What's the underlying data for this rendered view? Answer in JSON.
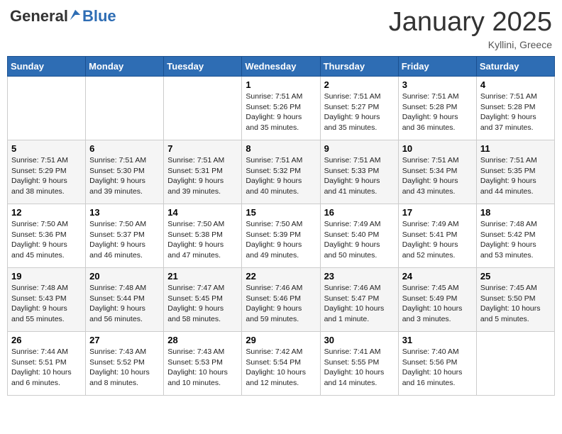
{
  "header": {
    "logo_general": "General",
    "logo_blue": "Blue",
    "month": "January 2025",
    "location": "Kyllini, Greece"
  },
  "days_of_week": [
    "Sunday",
    "Monday",
    "Tuesday",
    "Wednesday",
    "Thursday",
    "Friday",
    "Saturday"
  ],
  "weeks": [
    [
      {
        "day": "",
        "content": ""
      },
      {
        "day": "",
        "content": ""
      },
      {
        "day": "",
        "content": ""
      },
      {
        "day": "1",
        "content": "Sunrise: 7:51 AM\nSunset: 5:26 PM\nDaylight: 9 hours\nand 35 minutes."
      },
      {
        "day": "2",
        "content": "Sunrise: 7:51 AM\nSunset: 5:27 PM\nDaylight: 9 hours\nand 35 minutes."
      },
      {
        "day": "3",
        "content": "Sunrise: 7:51 AM\nSunset: 5:28 PM\nDaylight: 9 hours\nand 36 minutes."
      },
      {
        "day": "4",
        "content": "Sunrise: 7:51 AM\nSunset: 5:28 PM\nDaylight: 9 hours\nand 37 minutes."
      }
    ],
    [
      {
        "day": "5",
        "content": "Sunrise: 7:51 AM\nSunset: 5:29 PM\nDaylight: 9 hours\nand 38 minutes."
      },
      {
        "day": "6",
        "content": "Sunrise: 7:51 AM\nSunset: 5:30 PM\nDaylight: 9 hours\nand 39 minutes."
      },
      {
        "day": "7",
        "content": "Sunrise: 7:51 AM\nSunset: 5:31 PM\nDaylight: 9 hours\nand 39 minutes."
      },
      {
        "day": "8",
        "content": "Sunrise: 7:51 AM\nSunset: 5:32 PM\nDaylight: 9 hours\nand 40 minutes."
      },
      {
        "day": "9",
        "content": "Sunrise: 7:51 AM\nSunset: 5:33 PM\nDaylight: 9 hours\nand 41 minutes."
      },
      {
        "day": "10",
        "content": "Sunrise: 7:51 AM\nSunset: 5:34 PM\nDaylight: 9 hours\nand 43 minutes."
      },
      {
        "day": "11",
        "content": "Sunrise: 7:51 AM\nSunset: 5:35 PM\nDaylight: 9 hours\nand 44 minutes."
      }
    ],
    [
      {
        "day": "12",
        "content": "Sunrise: 7:50 AM\nSunset: 5:36 PM\nDaylight: 9 hours\nand 45 minutes."
      },
      {
        "day": "13",
        "content": "Sunrise: 7:50 AM\nSunset: 5:37 PM\nDaylight: 9 hours\nand 46 minutes."
      },
      {
        "day": "14",
        "content": "Sunrise: 7:50 AM\nSunset: 5:38 PM\nDaylight: 9 hours\nand 47 minutes."
      },
      {
        "day": "15",
        "content": "Sunrise: 7:50 AM\nSunset: 5:39 PM\nDaylight: 9 hours\nand 49 minutes."
      },
      {
        "day": "16",
        "content": "Sunrise: 7:49 AM\nSunset: 5:40 PM\nDaylight: 9 hours\nand 50 minutes."
      },
      {
        "day": "17",
        "content": "Sunrise: 7:49 AM\nSunset: 5:41 PM\nDaylight: 9 hours\nand 52 minutes."
      },
      {
        "day": "18",
        "content": "Sunrise: 7:48 AM\nSunset: 5:42 PM\nDaylight: 9 hours\nand 53 minutes."
      }
    ],
    [
      {
        "day": "19",
        "content": "Sunrise: 7:48 AM\nSunset: 5:43 PM\nDaylight: 9 hours\nand 55 minutes."
      },
      {
        "day": "20",
        "content": "Sunrise: 7:48 AM\nSunset: 5:44 PM\nDaylight: 9 hours\nand 56 minutes."
      },
      {
        "day": "21",
        "content": "Sunrise: 7:47 AM\nSunset: 5:45 PM\nDaylight: 9 hours\nand 58 minutes."
      },
      {
        "day": "22",
        "content": "Sunrise: 7:46 AM\nSunset: 5:46 PM\nDaylight: 9 hours\nand 59 minutes."
      },
      {
        "day": "23",
        "content": "Sunrise: 7:46 AM\nSunset: 5:47 PM\nDaylight: 10 hours\nand 1 minute."
      },
      {
        "day": "24",
        "content": "Sunrise: 7:45 AM\nSunset: 5:49 PM\nDaylight: 10 hours\nand 3 minutes."
      },
      {
        "day": "25",
        "content": "Sunrise: 7:45 AM\nSunset: 5:50 PM\nDaylight: 10 hours\nand 5 minutes."
      }
    ],
    [
      {
        "day": "26",
        "content": "Sunrise: 7:44 AM\nSunset: 5:51 PM\nDaylight: 10 hours\nand 6 minutes."
      },
      {
        "day": "27",
        "content": "Sunrise: 7:43 AM\nSunset: 5:52 PM\nDaylight: 10 hours\nand 8 minutes."
      },
      {
        "day": "28",
        "content": "Sunrise: 7:43 AM\nSunset: 5:53 PM\nDaylight: 10 hours\nand 10 minutes."
      },
      {
        "day": "29",
        "content": "Sunrise: 7:42 AM\nSunset: 5:54 PM\nDaylight: 10 hours\nand 12 minutes."
      },
      {
        "day": "30",
        "content": "Sunrise: 7:41 AM\nSunset: 5:55 PM\nDaylight: 10 hours\nand 14 minutes."
      },
      {
        "day": "31",
        "content": "Sunrise: 7:40 AM\nSunset: 5:56 PM\nDaylight: 10 hours\nand 16 minutes."
      },
      {
        "day": "",
        "content": ""
      }
    ]
  ]
}
